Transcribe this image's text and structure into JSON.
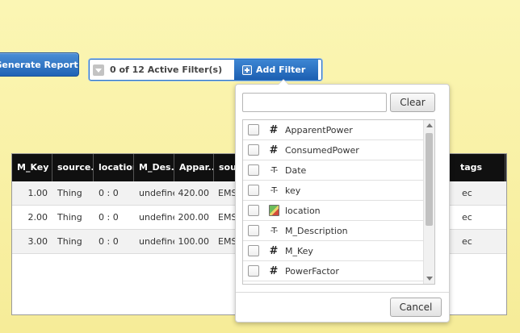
{
  "toolbar": {
    "generate_report_label": "Generate Report",
    "filter_count_label": "0 of 12 Active Filter(s)",
    "add_filter_label": "Add Filter"
  },
  "grid": {
    "columns": [
      "M_Key",
      "source...",
      "location",
      "M_Des...",
      "Appar...",
      "sou",
      "tags"
    ],
    "rows": [
      {
        "m_key": "1.00",
        "source": "Thing",
        "location": "0 : 0",
        "m_desc": "undefinec",
        "apparent": "420.00",
        "sou": "EMS",
        "tags": "ec"
      },
      {
        "m_key": "2.00",
        "source": "Thing",
        "location": "0 : 0",
        "m_desc": "undefinec",
        "apparent": "200.00",
        "sou": "EMS",
        "tags": "ec"
      },
      {
        "m_key": "3.00",
        "source": "Thing",
        "location": "0 : 0",
        "m_desc": "undefinec",
        "apparent": "100.00",
        "sou": "EMS",
        "tags": "ec"
      }
    ]
  },
  "filter_popup": {
    "search_value": "",
    "clear_label": "Clear",
    "cancel_label": "Cancel",
    "items": [
      {
        "label": "ApparentPower",
        "type_glyph": "#",
        "icon": "number-icon"
      },
      {
        "label": "ConsumedPower",
        "type_glyph": "#",
        "icon": "number-icon"
      },
      {
        "label": "Date",
        "type_glyph": "-T-",
        "icon": "text-icon"
      },
      {
        "label": "key",
        "type_glyph": "-T-",
        "icon": "text-icon"
      },
      {
        "label": "location",
        "type_glyph": "",
        "icon": "location-icon"
      },
      {
        "label": "M_Description",
        "type_glyph": "-T-",
        "icon": "text-icon"
      },
      {
        "label": "M_Key",
        "type_glyph": "#",
        "icon": "number-icon"
      },
      {
        "label": "PowerFactor",
        "type_glyph": "#",
        "icon": "number-icon"
      }
    ]
  }
}
